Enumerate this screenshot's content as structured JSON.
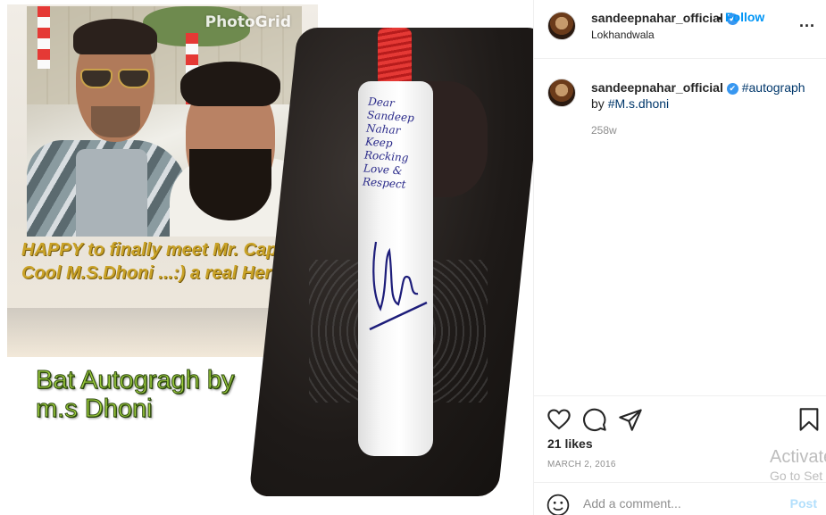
{
  "post_image": {
    "watermark": "PhotoGrid",
    "caption_top": "HAPPY to finally meet Mr. Captain Cool M.S.Dhoni ...:) a real Hero..",
    "caption_bottom_line1": "Bat Autogragh by",
    "caption_bottom_line2": "m.s Dhoni",
    "bat_writing": "Dear Sandeep Nahar Keep Rocking Love & Respect"
  },
  "header": {
    "username": "sandeepnahar_official",
    "separator": "•",
    "follow_label": "Follow",
    "location": "Lokhandwala",
    "more_label": "..."
  },
  "caption_comment": {
    "username": "sandeepnahar_official",
    "hashtag": "#autograph",
    "text_by": "by",
    "mention": "#M.s.dhoni",
    "time_ago": "258w"
  },
  "actions": {
    "likes": "21 likes",
    "date": "MARCH 2, 2016",
    "comment_placeholder": "Add a comment...",
    "post_label": "Post"
  },
  "os_watermark": {
    "line1": "Activate",
    "line2": "Go to Set"
  },
  "colors": {
    "accent": "#0095f6",
    "verified": "#3897f0",
    "caption_gold": "#c9a227",
    "caption_green": "#9ccc3c"
  },
  "icons": [
    "heart-icon",
    "comment-icon",
    "share-icon",
    "bookmark-icon",
    "emoji-icon",
    "verified-icon",
    "more-icon"
  ]
}
